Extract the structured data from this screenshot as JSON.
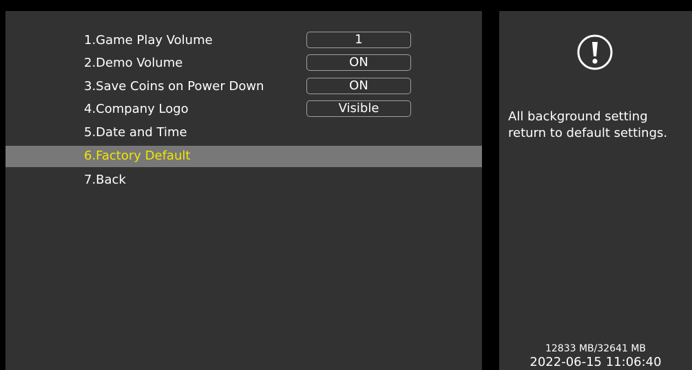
{
  "menu": {
    "items": [
      {
        "label": "1.Game Play Volume",
        "value": "1"
      },
      {
        "label": "2.Demo Volume",
        "value": "ON"
      },
      {
        "label": "3.Save Coins on Power Down",
        "value": "ON"
      },
      {
        "label": "4.Company Logo",
        "value": "Visible"
      },
      {
        "label": "5.Date and Time"
      },
      {
        "label": "6.Factory Default",
        "selected": true
      },
      {
        "label": "7.Back"
      }
    ]
  },
  "info": {
    "icon": "exclamation-circle-icon",
    "description": "All background setting return to default settings.",
    "storage": "12833 MB/32641 MB",
    "datetime": "2022-06-15 11:06:40"
  },
  "colors": {
    "panel_background": "#323232",
    "selected_row_background": "#787878",
    "selected_text": "#f2e600",
    "text": "#ffffff"
  }
}
